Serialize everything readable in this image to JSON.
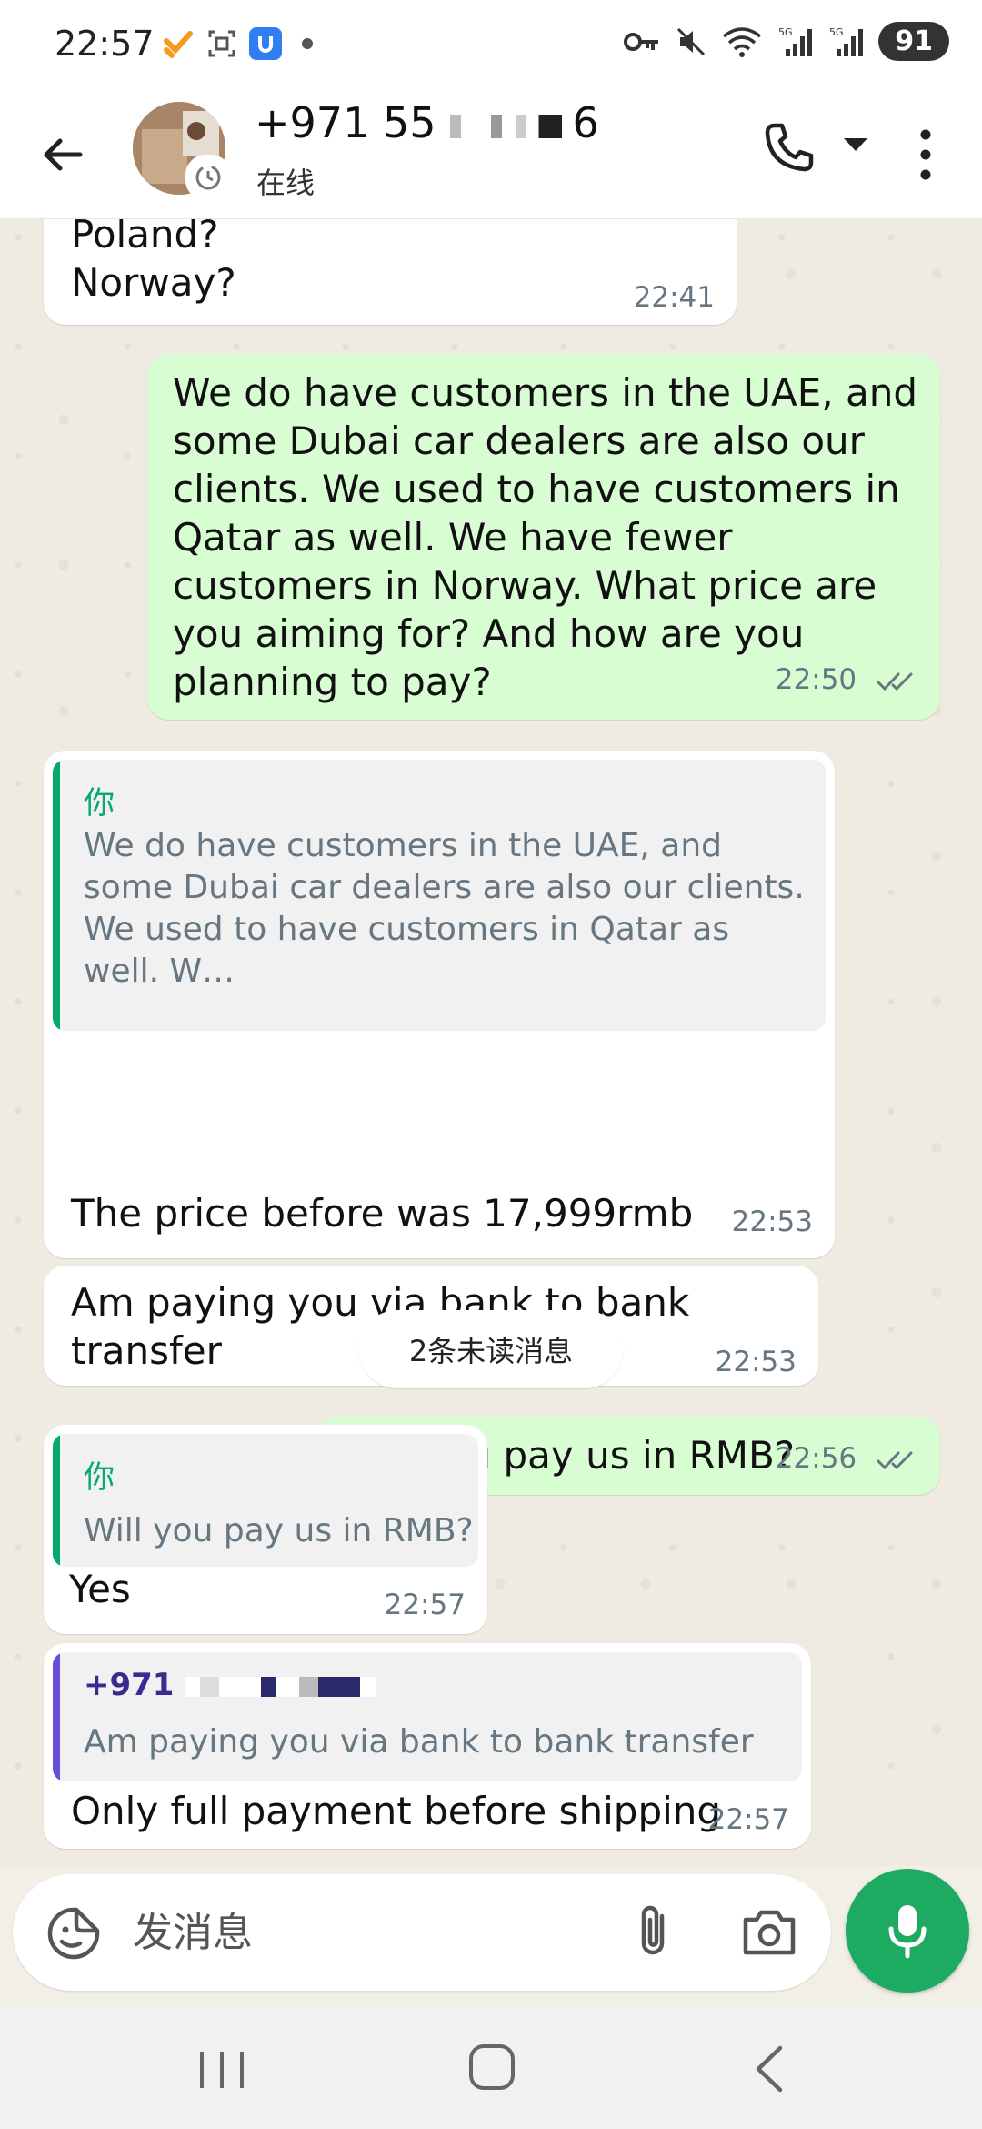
{
  "status_bar": {
    "time": "22:57",
    "battery": "91",
    "left_icons": [
      "app-notification-icon",
      "screenshot-icon",
      "vpn-shield-icon"
    ],
    "right_icons": [
      "key-icon",
      "mute-icon",
      "wifi-icon",
      "signal-5g-icon",
      "signal-5g-icon"
    ]
  },
  "header": {
    "contact_prefix": "+971 55",
    "contact_suffix": "6",
    "status": "在线"
  },
  "messages": [
    {
      "id": "m1",
      "dir": "in",
      "text_lines": [
        "Poland?",
        "Norway?"
      ],
      "time": "22:41"
    },
    {
      "id": "m2",
      "dir": "out",
      "text": "We do have customers in the UAE, and some Dubai car dealers are also our clients. We used to have customers in Qatar as well. We have fewer customers in Norway. What price are you aiming for? And how are you planning to pay?",
      "time": "22:50",
      "status": "read"
    },
    {
      "id": "m3",
      "dir": "in",
      "quote": {
        "author": "你",
        "text": "We do have customers in the UAE, and some Dubai car dealers are also our clients. We used to have customers in Qatar as well. W…"
      },
      "text": "The price before was 17,999rmb",
      "time": "22:53"
    },
    {
      "id": "m4",
      "dir": "in",
      "text": "Am paying you via bank to bank transfer",
      "time": "22:53"
    },
    {
      "id": "m5",
      "dir": "out",
      "text": "Will you pay us in RMB?",
      "time": "22:56",
      "status": "read"
    },
    {
      "id": "m6",
      "dir": "in",
      "quote": {
        "author": "你",
        "text": "Will you pay us in RMB?"
      },
      "text": "Yes",
      "time": "22:57"
    },
    {
      "id": "m7",
      "dir": "in",
      "quote": {
        "author": "+971",
        "text": "Am paying you via bank to bank transfer"
      },
      "text": "Only full payment before shipping",
      "time": "22:57"
    }
  ],
  "unread_divider": "2条未读消息",
  "composer": {
    "placeholder": "发消息"
  },
  "colors": {
    "outgoing_bubble": "#d9fdd3",
    "incoming_bubble": "#ffffff",
    "accent_green": "#1daa61",
    "quote_self_bar": "#06a96b",
    "quote_other_bar": "#6a4dd8",
    "read_ticks": "#667781"
  }
}
